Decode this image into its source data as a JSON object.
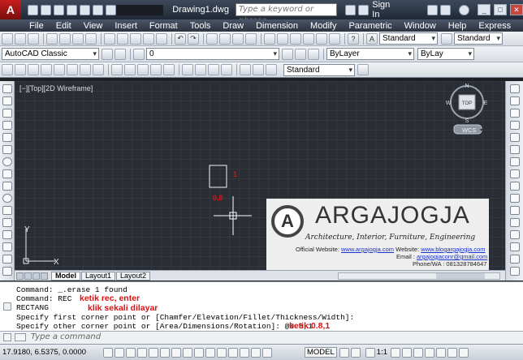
{
  "titlebar": {
    "app_icon": "A",
    "doc_title": "Drawing1.dwg",
    "search_placeholder": "Type a keyword or phrase",
    "sign_in": "Sign In"
  },
  "menu": {
    "items": [
      "File",
      "Edit",
      "View",
      "Insert",
      "Format",
      "Tools",
      "Draw",
      "Dimension",
      "Modify",
      "Parametric",
      "Window",
      "Help",
      "Express"
    ]
  },
  "toolbar1": {
    "style_combo": "Standard",
    "style_combo2": "Standard"
  },
  "toolbar2": {
    "workspace": "AutoCAD Classic",
    "layer": "0",
    "color": "ByLayer",
    "linetype": "ByLay"
  },
  "toolbar3": {
    "dimstyle": "Standard"
  },
  "viewport": {
    "label": "[−][Top][2D Wireframe]",
    "compass": {
      "N": "N",
      "S": "S",
      "W": "W",
      "E": "E",
      "center": "TOP"
    },
    "wcs": "WCS",
    "annotation_1": "1",
    "annotation_08": "0,8"
  },
  "tabs": {
    "items": [
      "Model",
      "Layout1",
      "Layout2"
    ]
  },
  "command": {
    "lines": [
      "Command: _.erase 1 found",
      "Command: REC",
      "RECTANG",
      "Specify first corner point or [Chamfer/Elevation/Fillet/Thickness/Width]:",
      "Specify other corner point or [Area/Dimensions/Rotation]: @0.8,1"
    ],
    "notes": [
      "ketik rec, enter",
      "klik sekali dilayar",
      "ketik 0.8,1"
    ],
    "prompt_placeholder": "Type a command"
  },
  "statusbar": {
    "coords": "17.9180, 6.5375, 0.0000",
    "model": "MODEL",
    "scale": "1:1"
  },
  "watermark": {
    "logo_letter": "A",
    "brand": "ARGAJOGJA",
    "tagline": "Architecture, Interior, Furniture, Engineering",
    "web_label": "Official Website:",
    "web1": "www.argajogja.com",
    "web_label2": "Website:",
    "web2": "www.blogargajogja.com",
    "email_label": "Email :",
    "email": "argajogjaconr@gmail.com",
    "phone": "Phone/WA : 081328784647"
  }
}
